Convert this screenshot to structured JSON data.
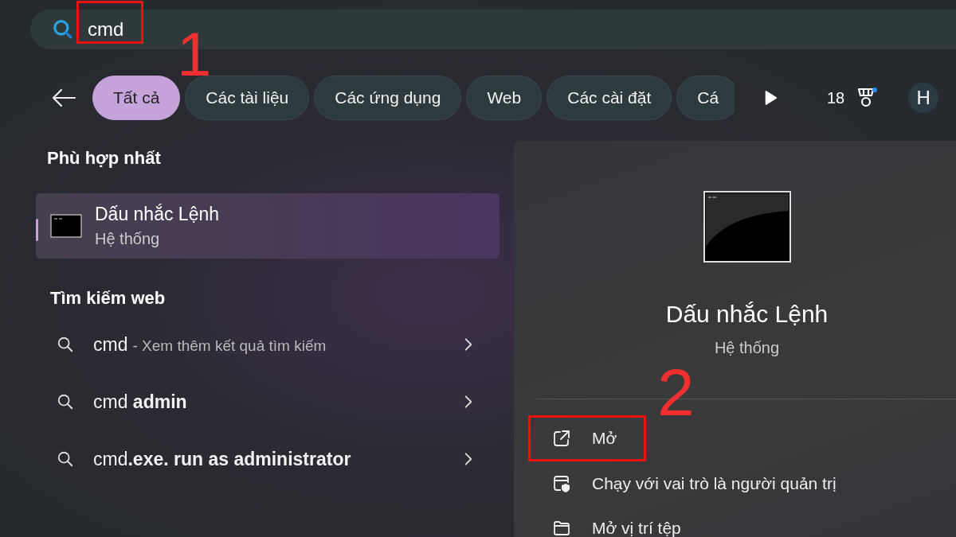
{
  "search": {
    "value": "cmd",
    "highlighted": true
  },
  "filters": [
    {
      "label": "Tất cả",
      "selected": true
    },
    {
      "label": "Các tài liệu",
      "selected": false
    },
    {
      "label": "Các ứng dụng",
      "selected": false
    },
    {
      "label": "Web",
      "selected": false
    },
    {
      "label": "Các cài đặt",
      "selected": false
    },
    {
      "label": "Cá",
      "selected": false
    }
  ],
  "points": "18",
  "avatar": "H",
  "best_match": {
    "heading": "Phù hợp nhất",
    "title": "Dấu nhắc Lệnh",
    "subtitle": "Hệ thống",
    "selected": true
  },
  "web_search": {
    "heading": "Tìm kiếm web",
    "items": [
      {
        "text": "cmd",
        "hint": "- Xem thêm kết quả tìm kiếm"
      },
      {
        "text": "cmd **admin**"
      },
      {
        "text": "cmd**.exe. run as administrator**"
      }
    ]
  },
  "detail": {
    "title": "Dấu nhắc Lệnh",
    "subtitle": "Hệ thống",
    "actions": [
      {
        "kind": "open",
        "label": "Mở",
        "highlighted": true
      },
      {
        "kind": "admin",
        "label": "Chạy với vai trò là người quản trị",
        "highlighted": false
      },
      {
        "kind": "folder",
        "label": "Mở vị trí tệp",
        "highlighted": false
      }
    ]
  },
  "annotations": [
    {
      "label": "1"
    },
    {
      "label": "2"
    }
  ]
}
